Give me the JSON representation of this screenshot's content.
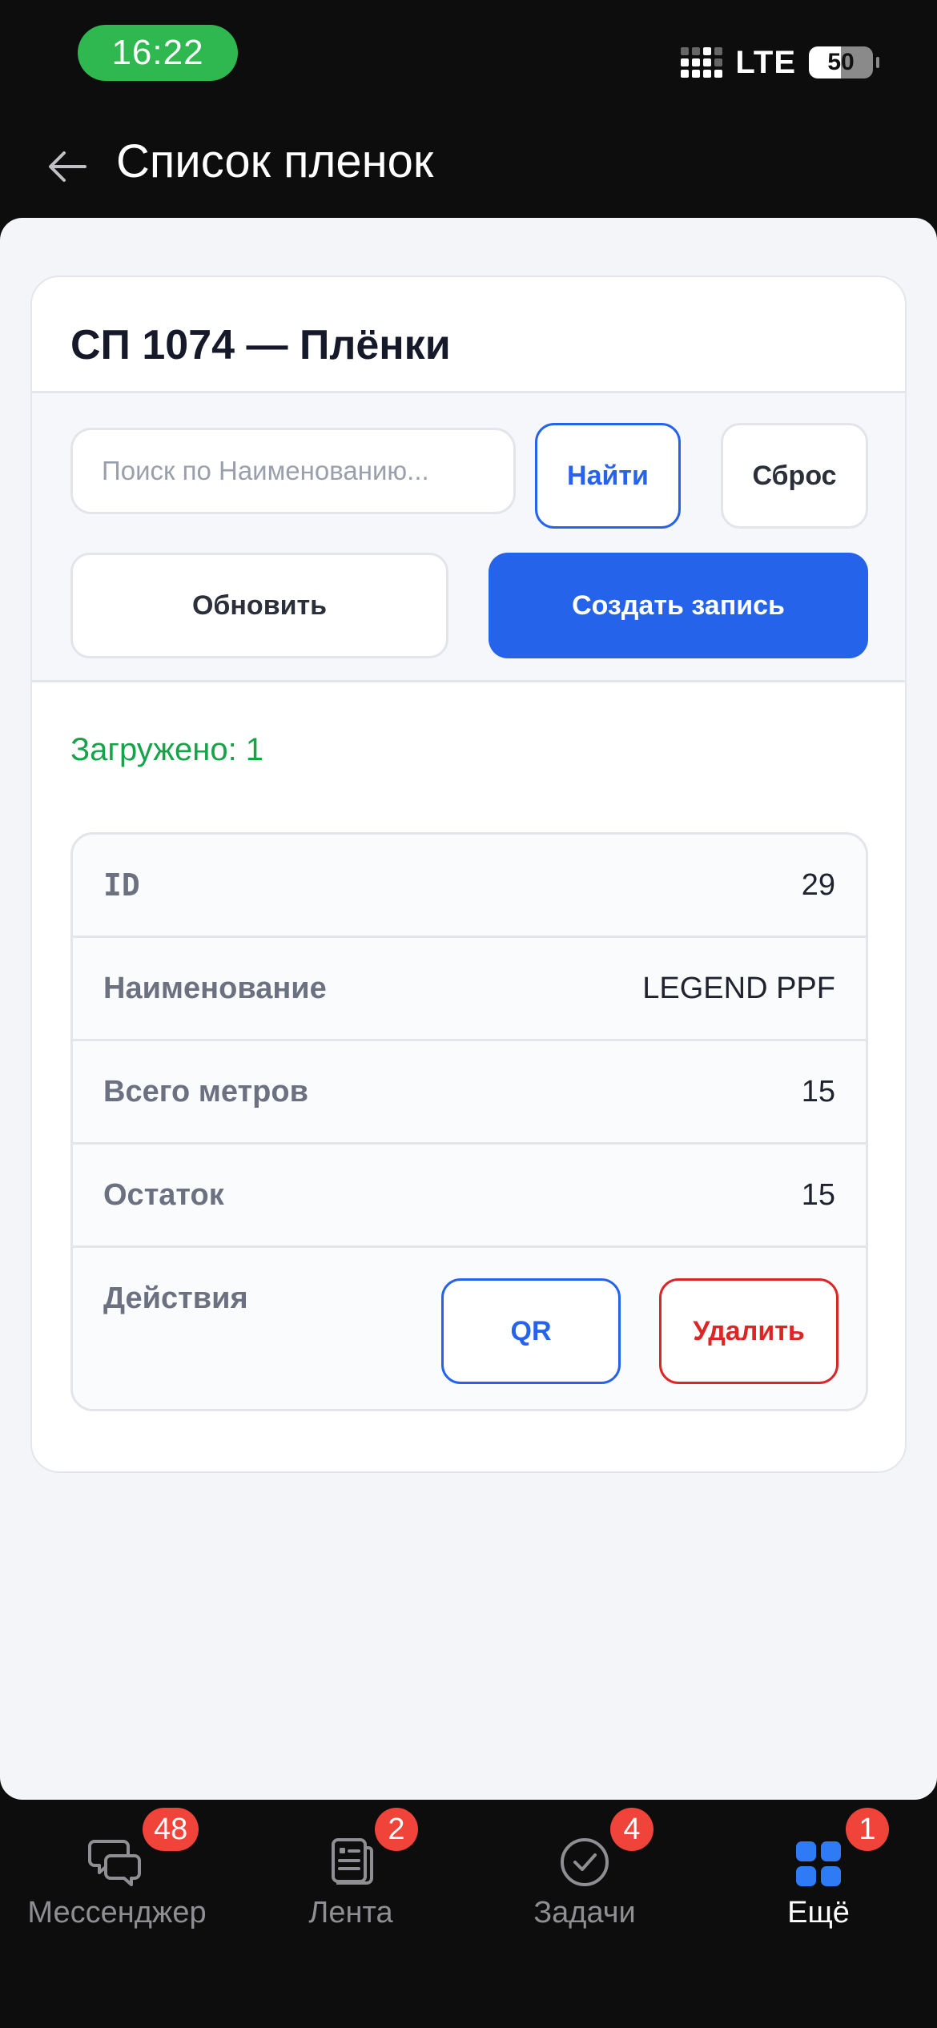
{
  "status_bar": {
    "time": "16:22",
    "network": "LTE",
    "battery": "50"
  },
  "nav": {
    "back_icon": "arrow-left-icon",
    "title": "Список пленок"
  },
  "card": {
    "title": "СП 1074 — Плёнки",
    "search": {
      "placeholder": "Поиск по Наименованию...",
      "value": ""
    },
    "buttons": {
      "find": "Найти",
      "reset": "Сброс",
      "refresh": "Обновить",
      "create": "Создать запись"
    },
    "loaded_text": "Загружено: 1",
    "record": {
      "rows": [
        {
          "label": "ID",
          "value": "29"
        },
        {
          "label": "Наименование",
          "value": "LEGEND PPF"
        },
        {
          "label": "Всего метров",
          "value": "15"
        },
        {
          "label": "Остаток",
          "value": "15"
        }
      ],
      "actions_label": "Действия",
      "qr_button": "QR",
      "delete_button": "Удалить"
    }
  },
  "tab_bar": {
    "tabs": [
      {
        "label": "Мессенджер",
        "icon": "chat-bubbles-icon",
        "badge": "48",
        "active": false
      },
      {
        "label": "Лента",
        "icon": "feed-icon",
        "badge": "2",
        "active": false
      },
      {
        "label": "Задачи",
        "icon": "check-circle-icon",
        "badge": "4",
        "active": false
      },
      {
        "label": "Ещё",
        "icon": "grid-icon",
        "badge": "1",
        "active": true
      }
    ]
  },
  "colors": {
    "accent": "#2563eb",
    "success": "#16a34a",
    "danger": "#dc2626",
    "badge": "#f0433a",
    "status_pill": "#2fb84f"
  }
}
